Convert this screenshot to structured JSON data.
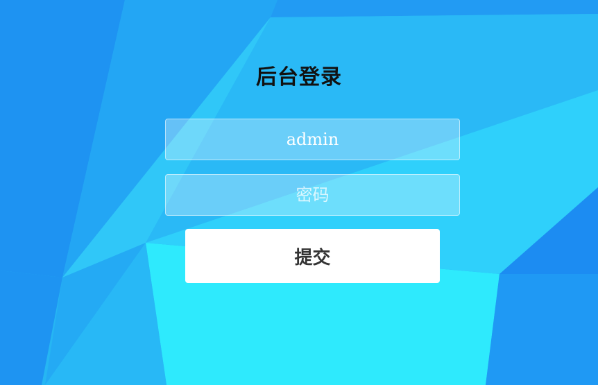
{
  "page": {
    "title": "后台登录"
  },
  "form": {
    "username_value": "admin",
    "password_placeholder": "密码",
    "submit_label": "提交"
  },
  "colors": {
    "background_base": "#2ab8f2",
    "panel_title": "#111111",
    "button_bg": "#ffffff",
    "button_text": "#333333"
  }
}
